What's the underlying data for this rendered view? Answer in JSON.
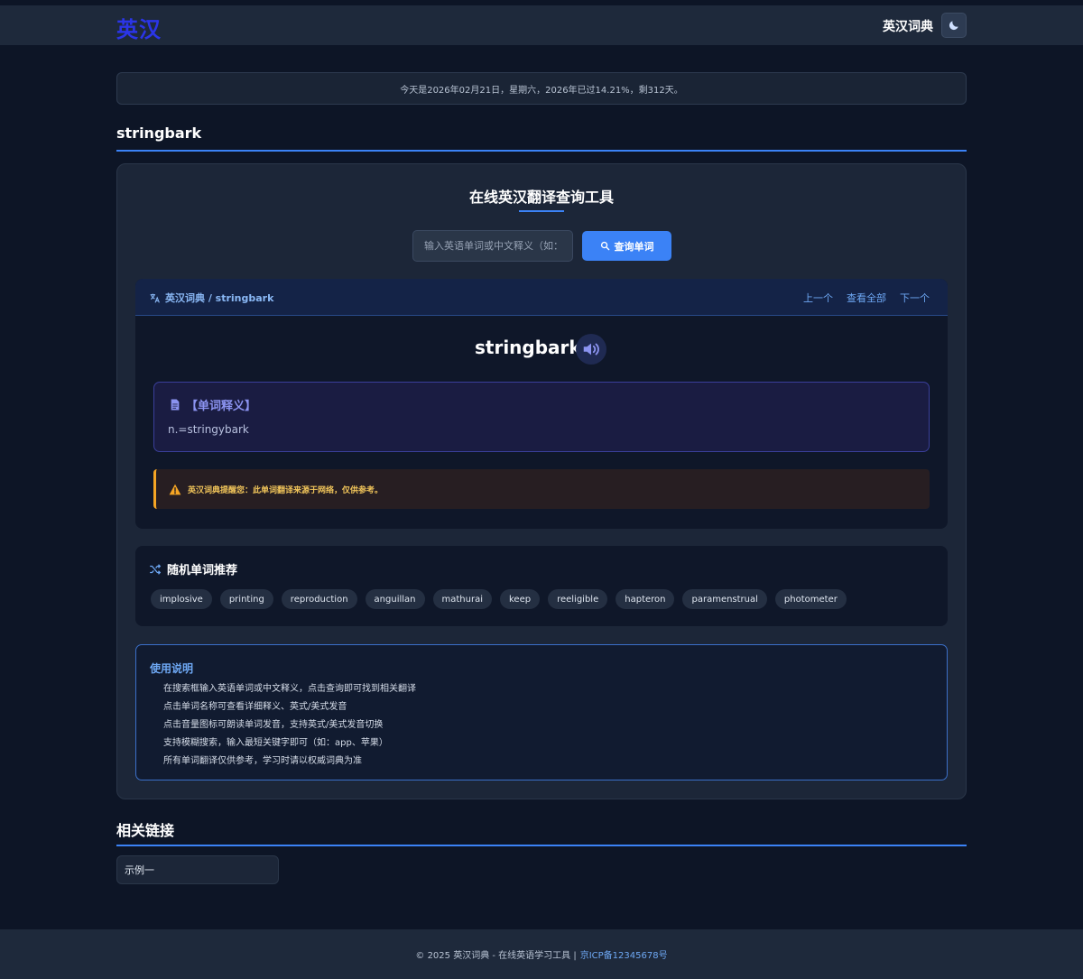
{
  "header": {
    "logo": "英汉",
    "title": "英汉词典",
    "theme_icon": "moon-icon"
  },
  "date_bar": {
    "text": "今天是2026年02月21日，星期六，2026年已过14.21%，剩312天。"
  },
  "word_heading": "stringbark",
  "tool": {
    "title": "在线英汉翻译查询工具",
    "search_placeholder": "输入英语单词或中文释义（如：apple、苹果）",
    "search_button": "查询单词",
    "search_icon": "search-icon"
  },
  "dict": {
    "breadcrumb": "英汉词典 / stringbark",
    "nav": {
      "prev": "上一个",
      "all": "查看全部",
      "next": "下一个"
    },
    "word": "stringbark",
    "speaker_icon": "speaker-icon",
    "definition_label": "【单词释义】",
    "definition": "n.=stringybark",
    "warning": "英汉词典提醒您：此单词翻译来源于网络，仅供参考。"
  },
  "random": {
    "title": "随机单词推荐",
    "words": [
      "implosive",
      "printing",
      "reproduction",
      "anguillan",
      "mathurai",
      "keep",
      "reeligible",
      "hapteron",
      "paramenstrual",
      "photometer"
    ]
  },
  "usage": {
    "title": "使用说明",
    "items": [
      "在搜索框输入英语单词或中文释义，点击查询即可找到相关翻译",
      "点击单词名称可查看详细释义、英式/美式发音",
      "点击音量图标可朗读单词发音，支持英式/美式发音切换",
      "支持模糊搜索，输入最短关键字即可（如：app、苹果）",
      "所有单词翻译仅供参考，学习时请以权威词典为准"
    ]
  },
  "related": {
    "title": "相关链接",
    "links": [
      "示例一"
    ]
  },
  "footer": {
    "text": "© 2025 英汉词典 - 在线英语学习工具 |",
    "icp": "京ICP备12345678号"
  },
  "colors": {
    "accent": "#3b82f6",
    "background": "#0d1526",
    "logo": "#2b35e8",
    "warning": "#f5a524"
  }
}
